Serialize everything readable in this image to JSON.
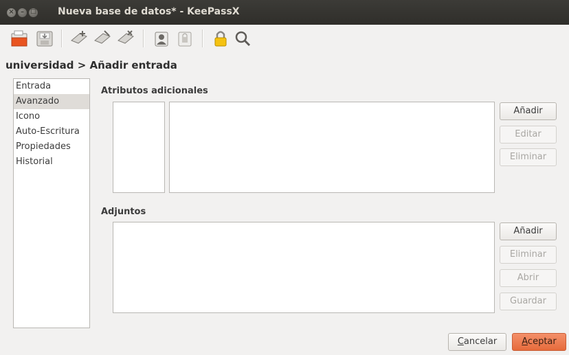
{
  "window": {
    "title": "Nueva base de datos* - KeePassX",
    "buttons": {
      "close": "×",
      "minimize": "–",
      "maximize": "□"
    }
  },
  "toolbar": {
    "items": [
      {
        "icon": "open-database-icon"
      },
      {
        "icon": "save-database-icon"
      },
      {
        "icon": "add-entry-icon"
      },
      {
        "icon": "edit-entry-icon"
      },
      {
        "icon": "delete-entry-icon"
      },
      {
        "icon": "copy-username-icon"
      },
      {
        "icon": "copy-password-icon"
      },
      {
        "icon": "lock-database-icon"
      },
      {
        "icon": "search-icon"
      }
    ]
  },
  "heading": "universidad > Añadir entrada",
  "categories": [
    {
      "label": "Entrada"
    },
    {
      "label": "Avanzado",
      "selected": true
    },
    {
      "label": "Icono"
    },
    {
      "label": "Auto-Escritura"
    },
    {
      "label": "Propiedades"
    },
    {
      "label": "Historial"
    }
  ],
  "attributes": {
    "title": "Atributos adicionales",
    "add": "Añadir",
    "edit": "Editar",
    "delete": "Eliminar"
  },
  "attachments": {
    "title": "Adjuntos",
    "add": "Añadir",
    "delete": "Eliminar",
    "open": "Abrir",
    "save": "Guardar"
  },
  "footer": {
    "cancel_mnemonic": "C",
    "cancel_rest": "ancelar",
    "accept_mnemonic": "A",
    "accept_rest": "ceptar"
  },
  "colors": {
    "titlebar": "#3c3b37",
    "accent": "#e66b3b",
    "selected": "#dfdcd8"
  }
}
